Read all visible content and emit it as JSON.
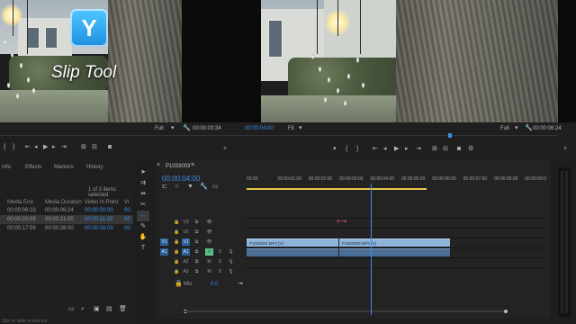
{
  "overlay": {
    "badge_letter": "Y",
    "tool_caption": "Slip Tool"
  },
  "source_monitor": {
    "zoom": "Full",
    "timecode": "00:00:03:34",
    "controls": [
      "mark-in-icon",
      "mark-out-icon",
      "go-to-in-icon",
      "step-back-icon",
      "play-icon",
      "step-forward-icon",
      "go-to-out-icon",
      "insert-icon",
      "overwrite-icon",
      "export-frame-icon"
    ]
  },
  "program_monitor": {
    "playhead_timecode": "00:00:04:00",
    "fit": "Fit",
    "zoom": "Full",
    "duration": "00:00:06:24",
    "controls": [
      "mark-in-icon",
      "mark-out-icon",
      "go-to-in-icon",
      "step-back-icon",
      "play-icon",
      "step-forward-icon",
      "go-to-out-icon",
      "lift-icon",
      "extract-icon",
      "export-frame-icon"
    ]
  },
  "project_panel": {
    "tabs": [
      "Info",
      "Effects",
      "Markers",
      "History"
    ],
    "selection_status": "1 of 3 items selected",
    "columns": [
      "Media End",
      "Media Duration",
      "Video In Point",
      "Vi"
    ],
    "rows": [
      {
        "media_end": "00:00:06:23",
        "media_duration": "00:00:06:24",
        "video_in": "00:00:00:00",
        "vi": "00",
        "selected": false
      },
      {
        "media_end": "00:00:20:09",
        "media_duration": "00:00:21:00",
        "video_in": "00:00:11:29",
        "vi": "00",
        "selected": true
      },
      {
        "media_end": "00:00:17:59",
        "media_duration": "00:00:28:00",
        "video_in": "00:00:06:09",
        "vi": "00",
        "selected": false
      }
    ],
    "status_bar": "Slip: to slide in and out"
  },
  "timeline": {
    "sequence_name": "P1033003",
    "timecode": "00:00:04:00",
    "ruler": [
      "00:00",
      "00:00:01:00",
      "00:00:02:00",
      "00:00:03:00",
      "00:00:04:00",
      "00:00:05:00",
      "00:00:06:00",
      "00:00:07:00",
      "00:00:08:00",
      "00:00:09:0"
    ],
    "tracks": [
      {
        "src": "",
        "name": "V3",
        "kind": "video"
      },
      {
        "src": "",
        "name": "V2",
        "kind": "video"
      },
      {
        "src": "V1",
        "name": "V1",
        "kind": "video"
      },
      {
        "src": "A1",
        "name": "A1",
        "kind": "audio"
      },
      {
        "src": "",
        "name": "A2",
        "kind": "audio"
      },
      {
        "src": "",
        "name": "A3",
        "kind": "audio"
      }
    ],
    "mix": {
      "label": "Mix",
      "value": "0.0"
    },
    "clips": [
      {
        "track": "V1",
        "label": "P1033002.MP4 [V]",
        "start": 0.0,
        "end": 3.0
      },
      {
        "track": "V1",
        "label": "P1033003.MP4 [V]",
        "start": 3.0,
        "end": 6.6
      },
      {
        "track": "A1",
        "label": "",
        "start": 0.0,
        "end": 3.0
      },
      {
        "track": "A1",
        "label": "",
        "start": 3.0,
        "end": 6.6
      }
    ],
    "playhead_seconds": 4.0
  },
  "colors": {
    "accent": "#3b8ee8",
    "clip_video": "#8fb4db",
    "clip_audio": "#4a6d95",
    "badge": "#2ea6f2"
  }
}
